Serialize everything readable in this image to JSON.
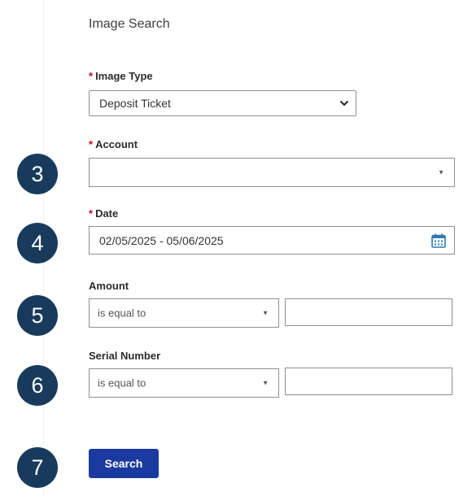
{
  "title": "Image Search",
  "required_marker": "*",
  "image_type": {
    "label": "Image Type",
    "value": "Deposit Ticket",
    "required": true
  },
  "account": {
    "label": "Account",
    "value": "",
    "required": true
  },
  "date": {
    "label": "Date",
    "value": "02/05/2025 - 05/06/2025",
    "required": true
  },
  "amount": {
    "label": "Amount",
    "operator": "is equal to",
    "value": ""
  },
  "serial_number": {
    "label": "Serial Number",
    "operator": "is equal to",
    "value": ""
  },
  "search_button": {
    "label": "Search"
  },
  "step_markers": [
    "3",
    "4",
    "5",
    "6",
    "7"
  ],
  "colors": {
    "required": "#d0021b",
    "button": "#1b3aa0",
    "marker": "#183b5c"
  }
}
